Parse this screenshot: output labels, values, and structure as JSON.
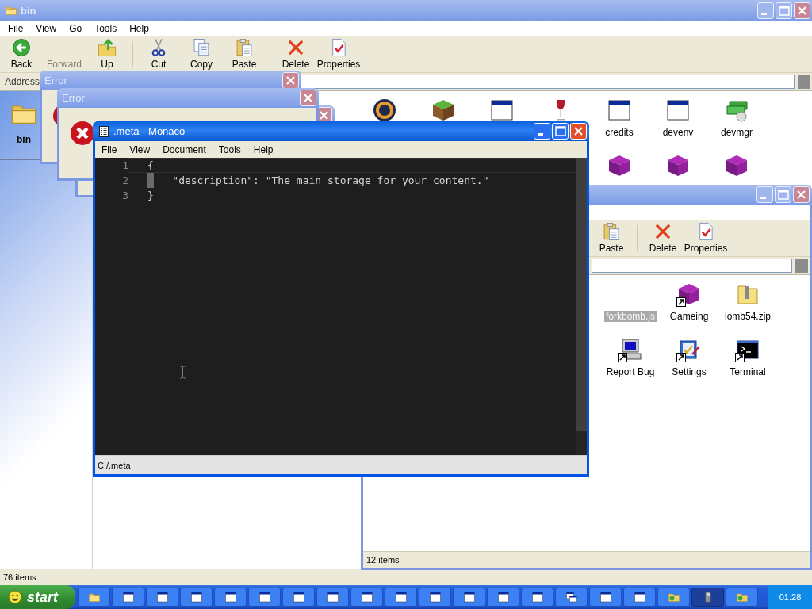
{
  "explorers": [
    {
      "title": "bin",
      "active": false,
      "menu": [
        "File",
        "View",
        "Go",
        "Tools",
        "Help"
      ],
      "toolbar": [
        {
          "kind": "back",
          "label": "Back",
          "disabled": false
        },
        {
          "kind": "forward",
          "label": "Forward",
          "disabled": true
        },
        {
          "kind": "up",
          "label": "Up",
          "disabled": false
        },
        {
          "kind": "separator"
        },
        {
          "kind": "cut",
          "label": "Cut",
          "disabled": false
        },
        {
          "kind": "copy",
          "label": "Copy",
          "disabled": false
        },
        {
          "kind": "paste",
          "label": "Paste",
          "disabled": false
        },
        {
          "kind": "separator"
        },
        {
          "kind": "delete",
          "label": "Delete",
          "disabled": false
        },
        {
          "kind": "properties",
          "label": "Properties",
          "disabled": false
        }
      ],
      "address_label": "Address",
      "sidebar": {
        "title": "bin"
      },
      "items": [
        {
          "kind": "ball",
          "selected": false,
          "shortcut": false
        },
        {
          "kind": "block",
          "selected": false,
          "shortcut": false
        },
        {
          "kind": "window",
          "selected": false,
          "shortcut": false
        },
        {
          "kind": "glass",
          "selected": false,
          "shortcut": false
        },
        {
          "kind": "window",
          "label": "credits",
          "selected": false,
          "shortcut": false
        },
        {
          "kind": "window",
          "label": "devenv",
          "selected": false,
          "shortcut": false
        },
        {
          "kind": "devices",
          "label": "devmgr",
          "selected": false,
          "shortcut": false
        },
        {
          "kind": "cube",
          "selected": false,
          "shortcut": false
        },
        {
          "kind": "cube",
          "selected": false,
          "shortcut": false
        },
        {
          "kind": "cube",
          "selected": false,
          "shortcut": false
        }
      ],
      "status": "76 items"
    },
    {
      "active": false,
      "toolbar": [
        {
          "kind": "paste",
          "label": "Paste",
          "disabled": false
        },
        {
          "kind": "separator"
        },
        {
          "kind": "delete",
          "label": "Delete",
          "disabled": false
        },
        {
          "kind": "properties",
          "label": "Properties",
          "disabled": false
        }
      ],
      "items": [
        {
          "label": "forkbomb.js",
          "selected": true
        },
        {
          "kind": "cube",
          "label": "Gameing",
          "selected": false,
          "shortcut": true
        },
        {
          "kind": "zip",
          "label": "iomb54.zip",
          "selected": false,
          "shortcut": false
        },
        {
          "kind": "computer",
          "label": "Report Bug",
          "selected": false,
          "shortcut": true
        },
        {
          "kind": "settings",
          "label": "Settings",
          "selected": false,
          "shortcut": true
        },
        {
          "kind": "terminal",
          "label": "Terminal",
          "selected": false,
          "shortcut": true
        }
      ],
      "status": "12 items"
    }
  ],
  "errors": [
    {
      "title": "Error",
      "active": false,
      "kind": "error"
    },
    {
      "title": "Error",
      "active": false,
      "kind": "error"
    },
    {
      "active": false
    }
  ],
  "editor": {
    "title": ".meta - Monaco",
    "active": true,
    "menu": [
      "File",
      "View",
      "Document",
      "Tools",
      "Help"
    ],
    "lines": [
      {
        "number": "1",
        "text": "{",
        "current": true,
        "marker": false
      },
      {
        "number": "2",
        "text": "    \"description\": \"The main storage for your content.\"",
        "current": false,
        "marker": true
      },
      {
        "number": "3",
        "text": "}",
        "current": false,
        "marker": false
      }
    ],
    "status": "C:/.meta"
  },
  "taskbar": {
    "start": "start",
    "clock": "01:28",
    "buttons": [
      {
        "kind": "folder",
        "selected": false
      },
      {
        "kind": "window",
        "selected": false
      },
      {
        "kind": "window",
        "selected": false
      },
      {
        "kind": "window",
        "selected": false
      },
      {
        "kind": "window",
        "selected": false
      },
      {
        "kind": "window",
        "selected": false
      },
      {
        "kind": "window",
        "selected": false
      },
      {
        "kind": "window",
        "selected": false
      },
      {
        "kind": "window",
        "selected": false
      },
      {
        "kind": "window",
        "selected": false
      },
      {
        "kind": "window",
        "selected": false
      },
      {
        "kind": "window",
        "selected": false
      },
      {
        "kind": "window",
        "selected": false
      },
      {
        "kind": "window",
        "selected": false
      },
      {
        "kind": "dialog",
        "selected": false
      },
      {
        "kind": "window",
        "selected": false
      },
      {
        "kind": "window",
        "selected": false
      },
      {
        "kind": "shared",
        "selected": false
      },
      {
        "kind": "device",
        "selected": true
      },
      {
        "kind": "shared",
        "selected": false
      }
    ]
  }
}
